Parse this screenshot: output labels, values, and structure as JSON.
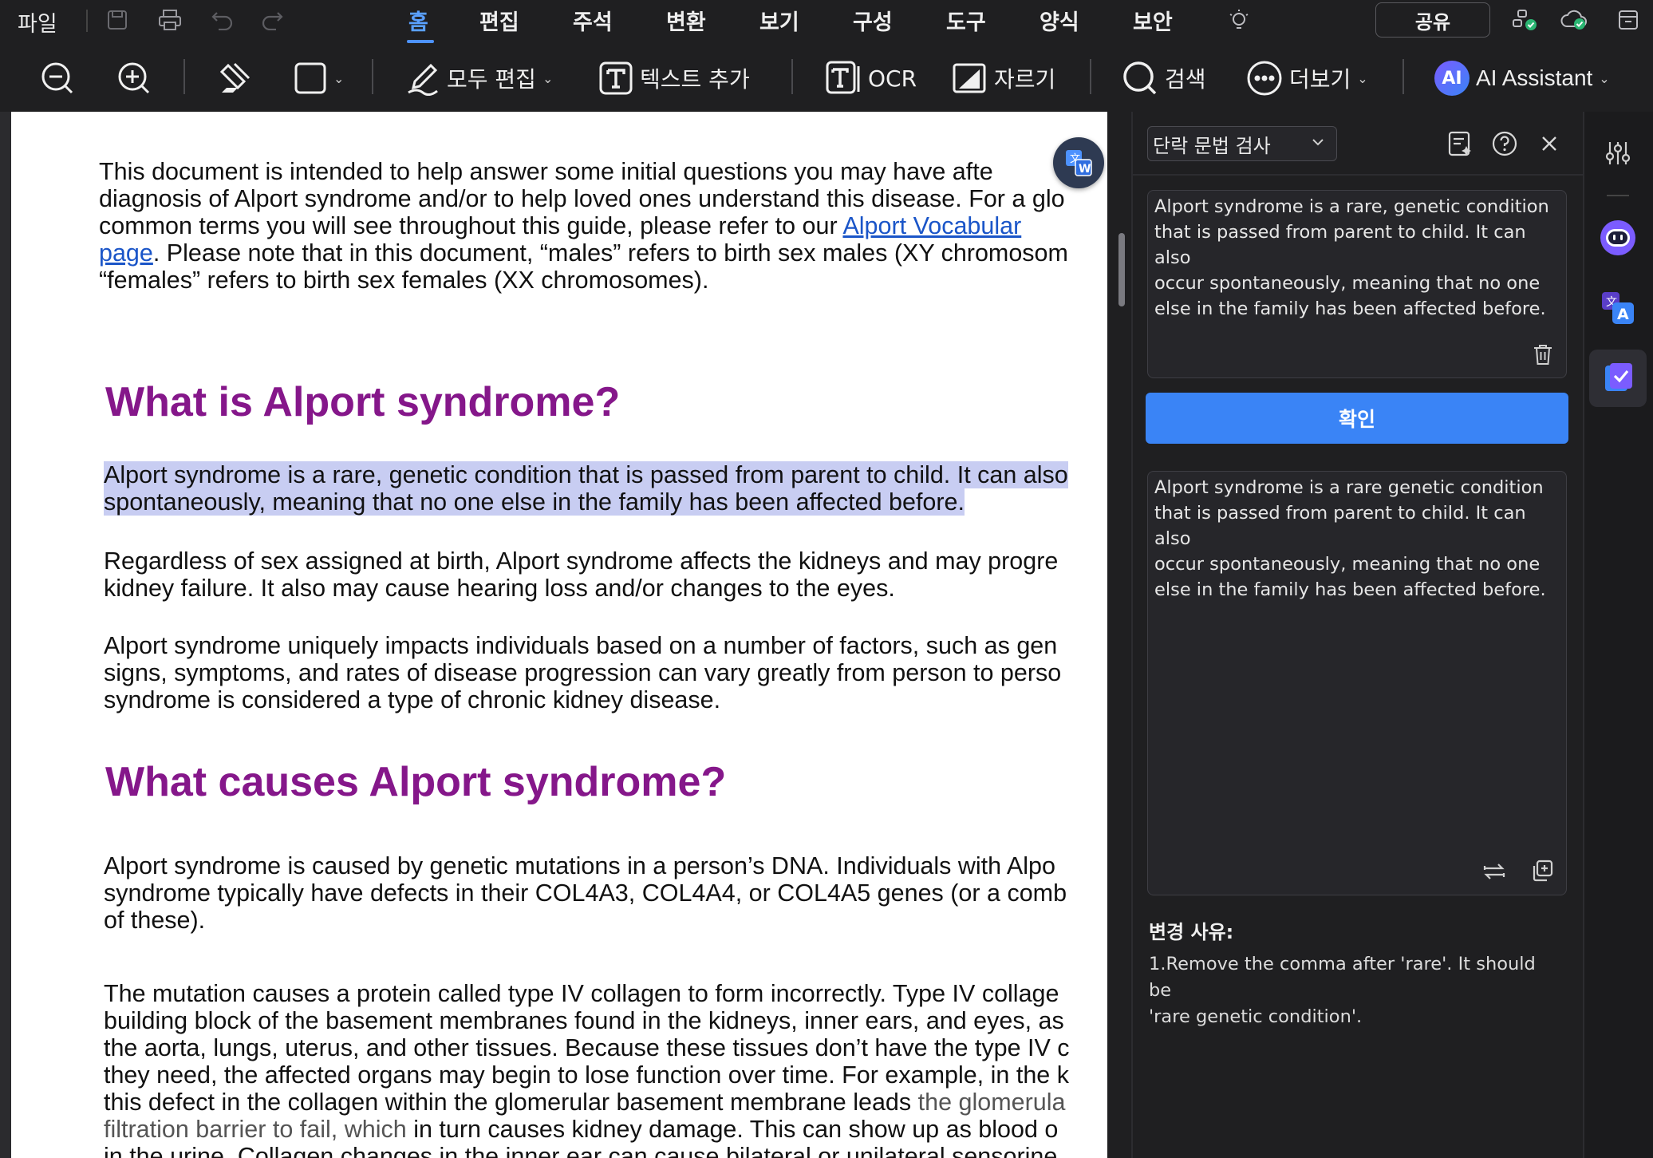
{
  "menu": {
    "file": "파일",
    "tabs": [
      "홈",
      "편집",
      "주석",
      "변환",
      "보기",
      "구성",
      "도구",
      "양식",
      "보안"
    ],
    "active_tab": "홈",
    "share": "공유"
  },
  "toolbar": {
    "edit_all": "모두 편집",
    "add_text": "텍스트 추가",
    "ocr": "OCR",
    "crop": "자르기",
    "search": "검색",
    "more": "더보기",
    "ai_badge": "AI",
    "ai_assistant": "AI Assistant"
  },
  "document": {
    "intro": "This document is intended to help answer some initial questions you may have afte\ndiagnosis of Alport syndrome and/or to help loved ones understand this disease. For a glo\ncommon terms you will see throughout this guide, please refer to our",
    "link1": "Alport Vocabular",
    "link2": "page",
    "intro_after_link": ". Please note that in this document, “males” refers to birth sex males (XY chromosom\n“females” refers to birth sex females (XX chromosomes).",
    "heading1": "What is Alport syndrome?",
    "selected_line1": "Alport syndrome is a rare, genetic condition that is passed from parent to child. It can also",
    "selected_line2": "spontaneously, meaning that no one else in the family has been affected before.",
    "para2": "Regardless of sex assigned at birth, Alport syndrome affects the kidneys and may progre\nkidney failure. It also may cause hearing loss and/or changes to the eyes.",
    "para3": "Alport syndrome uniquely impacts individuals based on a number of factors, such as gen\nsigns, symptoms, and rates of disease progression can vary greatly from person to perso\nsyndrome is considered a type of chronic kidney disease.",
    "heading2": "What causes Alport syndrome?",
    "para4": "Alport syndrome is caused by genetic mutations in a person’s DNA. Individuals with Alpo\nsyndrome typically have defects in their COL4A3, COL4A4, or COL4A5 genes (or a comb\nof these).",
    "para5": "The mutation causes a protein called type IV collagen to form incorrectly. Type IV collage\nbuilding block of the basement membranes found in the kidneys, inner ears, and eyes, as\nthe aorta, lungs, uterus, and other tissues. Because these tissues don’t have the type IV c\nthey need, the affected organs may begin to lose function over time. For example, in the k\nthis defect in the collagen within the glomerular basement membrane leads",
    "para5_gray1": "the glomerula",
    "para5_gray2": "filtration barrier to fail, which",
    "para5_tail": "in turn causes kidney damage. This can show up as blood o",
    "para5_last": "in the urine. Collagen changes in the inner ear can cause bilateral or unilateral sensorine"
  },
  "panel": {
    "mode": "단락 문법 검사",
    "input_text": "Alport syndrome is a rare, genetic condition\nthat is passed from parent to child. It can also\noccur spontaneously, meaning that no one\nelse in the family has been affected before.",
    "confirm": "확인",
    "output_text": "Alport syndrome is a rare genetic condition\nthat is passed from parent to child. It can also\noccur spontaneously, meaning that no one\nelse in the family has been affected before.",
    "reason_title": "변경 사유:",
    "reason_text": "1.Remove the comma after 'rare'. It should be\n'rare genetic condition'."
  },
  "colors": {
    "accent": "#3a84f6",
    "heading": "#85178a",
    "selection": "#c8cdf2",
    "link": "#1a55c8"
  },
  "icons": {
    "topbar": [
      "save-icon",
      "print-icon",
      "undo-icon",
      "redo-icon",
      "lightbulb-icon",
      "account-status-icon",
      "cloud-sync-icon",
      "window-icon"
    ],
    "toolbar": [
      "zoom-out-icon",
      "zoom-in-icon",
      "highlighter-icon",
      "rectangle-select-icon",
      "edit-pen-icon",
      "text-box-icon",
      "ocr-icon",
      "crop-icon",
      "search-icon",
      "more-icon"
    ],
    "panel": [
      "ai-note-icon",
      "help-icon",
      "close-icon",
      "trash-icon",
      "replace-icon",
      "copy-icon"
    ],
    "rail": [
      "settings-sliders-icon",
      "chatbot-icon",
      "translate-icon",
      "grammar-check-icon"
    ]
  }
}
